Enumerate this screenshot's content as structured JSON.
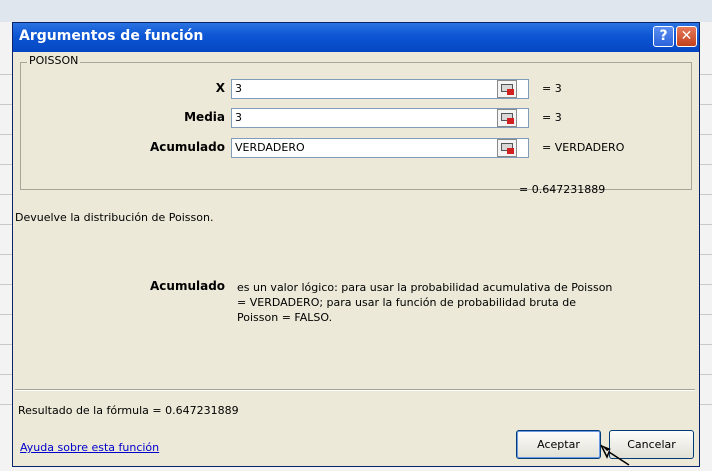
{
  "dialog": {
    "title": "Argumentos de función",
    "help_glyph": "?",
    "close_glyph": "✕",
    "group_label": "POISSON",
    "arguments": [
      {
        "label": "X",
        "input": "3",
        "value": "= 3"
      },
      {
        "label": "Media",
        "input": "3",
        "value": "= 3"
      },
      {
        "label": "Acumulado",
        "input": "VERDADERO",
        "value": "= VERDADERO"
      }
    ],
    "result_top": "= 0.647231889",
    "description": "Devuelve la distribución de Poisson.",
    "arg_help": {
      "term": "Acumulado",
      "lines": [
        "es un valor lógico: para usar la probabilidad acumulativa de Poisson",
        "= VERDADERO; para usar la función de probabilidad bruta de",
        "Poisson = FALSO."
      ]
    },
    "formula_result": "Resultado de la fórmula =  0.647231889",
    "help_link": "Ayuda sobre esta función",
    "ok_label": "Aceptar",
    "cancel_label": "Cancelar"
  },
  "colors": {
    "titlebar": "#0c55d4",
    "dialog_bg": "#ece9d8",
    "link": "#0000cc",
    "ref_icon_red": "#d02020"
  }
}
